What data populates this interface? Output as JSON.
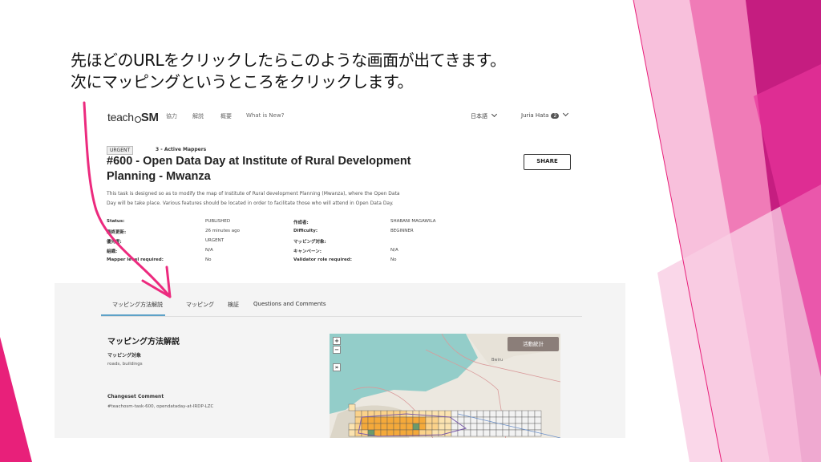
{
  "slide": {
    "caption_line1": "先ほどのURLをクリックしたらこのような画面が出てきます。",
    "caption_line2": "次にマッピングというところをクリックします。",
    "colors": {
      "accent": "#e8207a",
      "pink_light": "#f5a8cf",
      "pink_dark": "#c0137a"
    }
  },
  "nav": {
    "logo_teach": "teach",
    "logo_osm": "SM",
    "items": [
      "協力",
      "解説",
      "概要",
      "What is New?"
    ],
    "language": "日本語",
    "user": "Juria Hata",
    "notifications": "2"
  },
  "project": {
    "badge": "URGENT",
    "mappers": "3 - Active Mappers",
    "title": "#600 - Open Data Day at Institute of Rural Development Planning - Mwanza",
    "share": "SHARE",
    "description_line1": "This task is designed so as to modify the map of Institute of Rural development Planning (Mwanza), where the Open Data",
    "description_line2": "Day will be take place. Various features should be located in order to facilitate those who will attend in Open Data Day.",
    "meta_left": [
      {
        "key": "Status:",
        "value": "PUBLISHED"
      },
      {
        "key": "最終更新:",
        "value": "26 minutes ago"
      },
      {
        "key": "優先度:",
        "value": "URGENT"
      },
      {
        "key": "組織:",
        "value": "N/A"
      },
      {
        "key": "Mapper level required:",
        "value": "No"
      }
    ],
    "meta_right": [
      {
        "key": "作成者:",
        "value": "SHABANI MAGAWILA"
      },
      {
        "key": "Difficulty:",
        "value": "BEGINNER"
      },
      {
        "key": "マッピング対象:",
        "value": ""
      },
      {
        "key": "キャンペーン:",
        "value": "N/A"
      },
      {
        "key": "Validator role required:",
        "value": "No"
      }
    ]
  },
  "tabs": [
    "マッピング方法解説",
    "マッピング",
    "検証",
    "Questions and Comments"
  ],
  "instructions": {
    "title": "マッピング方法解説",
    "mapping_target_label": "マッピング対象",
    "mapping_target_value": "roads, buildings",
    "changeset_label": "Changeset Comment",
    "changeset_value": "#teachosm-task-600, opendataday-at-IRDP-LZC"
  },
  "map": {
    "zoom_in": "+",
    "zoom_out": "−",
    "layers": "»",
    "stats_button": "活動統計",
    "place_label": "Bwiru"
  }
}
